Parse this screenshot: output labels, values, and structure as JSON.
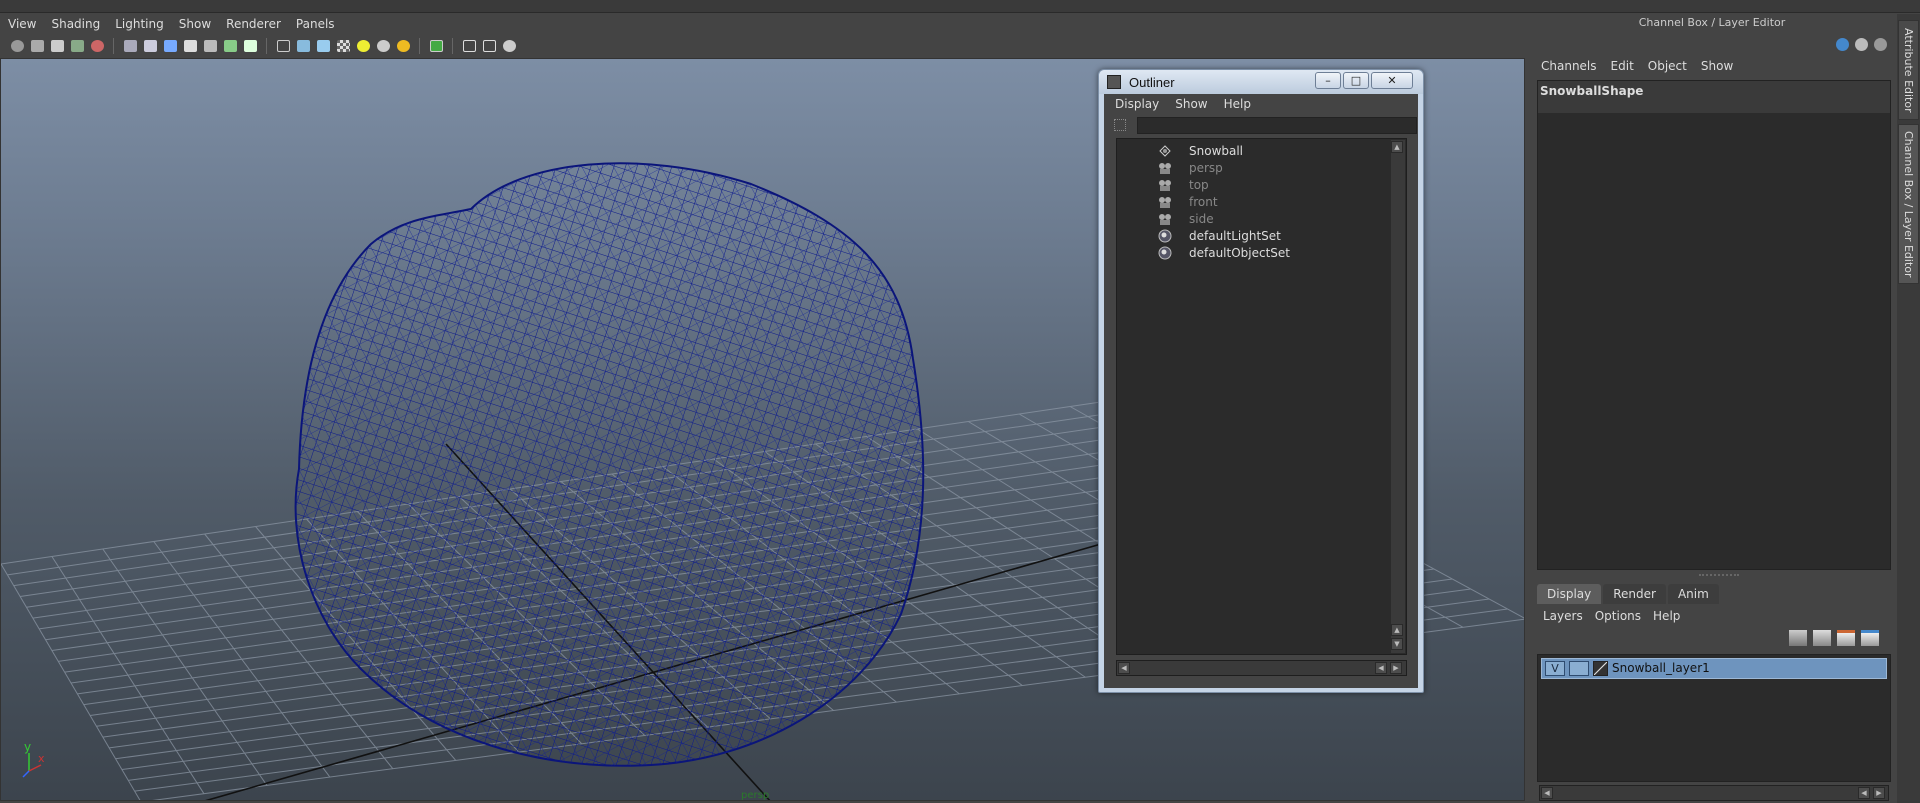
{
  "viewport_menu": [
    "View",
    "Shading",
    "Lighting",
    "Show",
    "Renderer",
    "Panels"
  ],
  "viewport_camera_label": "persp",
  "axis": {
    "y": "y",
    "x": "x"
  },
  "outliner": {
    "title": "Outliner",
    "menu": [
      "Display",
      "Show",
      "Help"
    ],
    "filter_value": "",
    "items": [
      {
        "label": "Snowball",
        "icon": "mesh-icon",
        "color": "#dddddd"
      },
      {
        "label": "persp",
        "icon": "camera-icon",
        "color": "#888888"
      },
      {
        "label": "top",
        "icon": "camera-icon",
        "color": "#888888"
      },
      {
        "label": "front",
        "icon": "camera-icon",
        "color": "#888888"
      },
      {
        "label": "side",
        "icon": "camera-icon",
        "color": "#888888"
      },
      {
        "label": "defaultLightSet",
        "icon": "set-icon",
        "color": "#dddddd"
      },
      {
        "label": "defaultObjectSet",
        "icon": "set-icon",
        "color": "#dddddd"
      }
    ]
  },
  "channel_box": {
    "title": "Channel Box / Layer Editor",
    "menu": [
      "Channels",
      "Edit",
      "Object",
      "Show"
    ],
    "selected_object": "SnowballShape"
  },
  "layer_editor": {
    "tabs": [
      "Display",
      "Render",
      "Anim"
    ],
    "active_tab": "Display",
    "menu": [
      "Layers",
      "Options",
      "Help"
    ],
    "layers": [
      {
        "visible": "V",
        "name": "Snowball_layer1"
      }
    ]
  },
  "side_tabs": [
    "Attribute Editor",
    "Channel Box / Layer Editor"
  ],
  "colors": {
    "wireframe": "#0d1a8a",
    "selection": "#6e94be",
    "grid": "#8f9aa8"
  }
}
